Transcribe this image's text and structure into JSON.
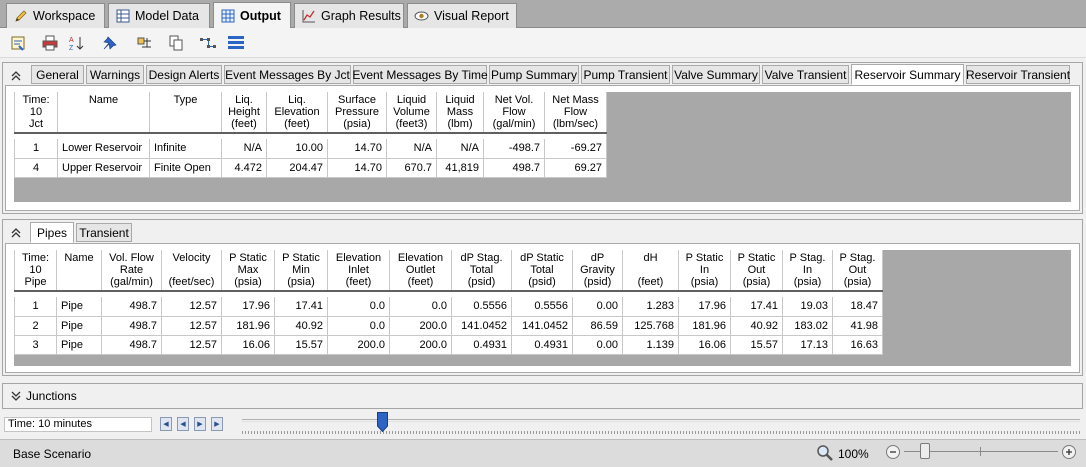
{
  "top_tabs": [
    {
      "label": "Workspace",
      "icon": "pencil-icon"
    },
    {
      "label": "Model Data",
      "icon": "table-icon"
    },
    {
      "label": "Output",
      "icon": "grid-icon"
    },
    {
      "label": "Graph Results",
      "icon": "chart-icon"
    },
    {
      "label": "Visual Report",
      "icon": "eye-icon"
    }
  ],
  "toolbar_icons": [
    "output-control-icon",
    "print-icon",
    "sort-icon",
    "pin-icon",
    "highlight-icon",
    "copy-icon",
    "transfer-icon",
    "list-icon"
  ],
  "reservoir_panel": {
    "tabs": [
      "General",
      "Warnings",
      "Design Alerts",
      "Event Messages By Jct",
      "Event Messages By Time",
      "Pump Summary",
      "Pump Transient",
      "Valve Summary",
      "Valve Transient",
      "Reservoir Summary",
      "Reservoir Transient"
    ],
    "active_tab": "Reservoir Summary",
    "headers": [
      "Time:\n10\nJct",
      "Name",
      "Type",
      "Liq.\nHeight\n(feet)",
      "Liq.\nElevation\n(feet)",
      "Surface\nPressure\n(psia)",
      "Liquid\nVolume\n(feet3)",
      "Liquid\nMass\n(lbm)",
      "Net Vol.\nFlow\n(gal/min)",
      "Net Mass\nFlow\n(lbm/sec)"
    ],
    "rows": [
      [
        "1",
        "Lower Reservoir",
        "Infinite",
        "N/A",
        "10.00",
        "14.70",
        "N/A",
        "N/A",
        "-498.7",
        "-69.27"
      ],
      [
        "4",
        "Upper Reservoir",
        "Finite Open",
        "4.472",
        "204.47",
        "14.70",
        "670.7",
        "41,819",
        "498.7",
        "69.27"
      ]
    ]
  },
  "pipes_panel": {
    "tabs": [
      "Pipes",
      "Transient"
    ],
    "active_tab": "Pipes",
    "headers": [
      "Time:\n10\nPipe",
      "Name",
      "Vol. Flow\nRate\n(gal/min)",
      "Velocity\n\n(feet/sec)",
      "P Static\nMax\n(psia)",
      "P Static\nMin\n(psia)",
      "Elevation\nInlet\n(feet)",
      "Elevation\nOutlet\n(feet)",
      "dP Stag.\nTotal\n(psid)",
      "dP Static\nTotal\n(psid)",
      "dP\nGravity\n(psid)",
      "dH\n\n(feet)",
      "P Static\nIn\n(psia)",
      "P Static\nOut\n(psia)",
      "P Stag.\nIn\n(psia)",
      "P Stag.\nOut\n(psia)"
    ],
    "rows": [
      [
        "1",
        "Pipe",
        "498.7",
        "12.57",
        "17.96",
        "17.41",
        "0.0",
        "0.0",
        "0.5556",
        "0.5556",
        "0.00",
        "1.283",
        "17.96",
        "17.41",
        "19.03",
        "18.47"
      ],
      [
        "2",
        "Pipe",
        "498.7",
        "12.57",
        "181.96",
        "40.92",
        "0.0",
        "200.0",
        "141.0452",
        "141.0452",
        "86.59",
        "125.768",
        "181.96",
        "40.92",
        "183.02",
        "41.98"
      ],
      [
        "3",
        "Pipe",
        "498.7",
        "12.57",
        "16.06",
        "15.57",
        "200.0",
        "200.0",
        "0.4931",
        "0.4931",
        "0.00",
        "1.139",
        "16.06",
        "15.57",
        "17.13",
        "16.63"
      ]
    ]
  },
  "junctions_panel": {
    "title": "Junctions"
  },
  "time_control": {
    "label": "Time: 10 minutes",
    "position_fraction": 0.16
  },
  "status_bar": {
    "scenario": "Base Scenario",
    "zoom": "100%"
  },
  "colors": {
    "accent_blue": "#2b64c4",
    "gray_fill": "#a8a8a8"
  }
}
